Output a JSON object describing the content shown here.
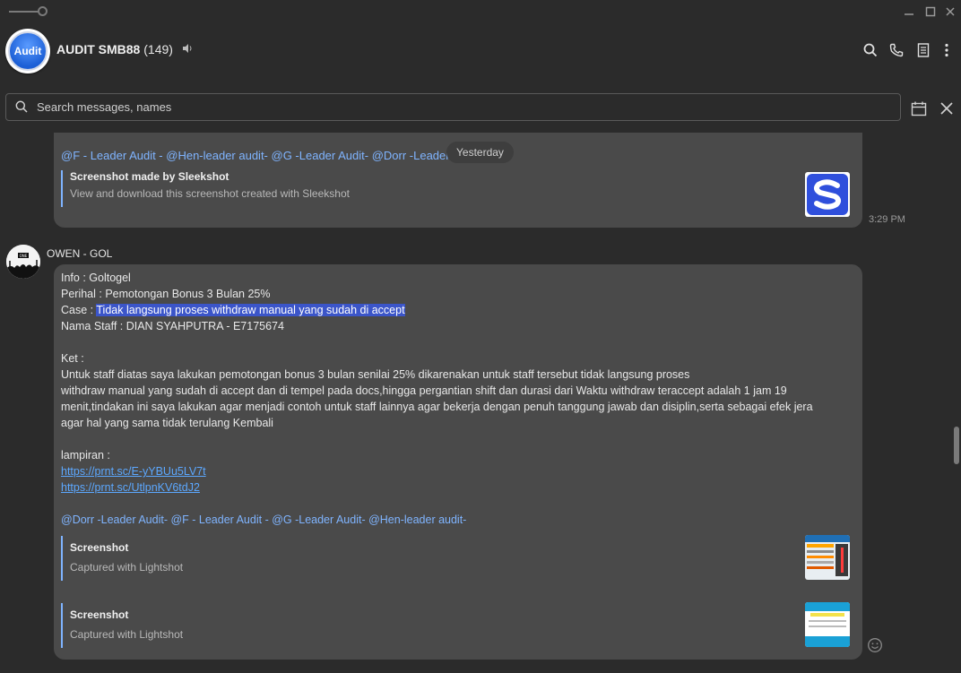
{
  "window": {
    "minimize_glyph": "—",
    "maximize_glyph": "☐",
    "close_glyph": "✕"
  },
  "header": {
    "avatar_text": "Audit",
    "title": "AUDIT SMB88",
    "member_count": "(149)",
    "icons": [
      "search-icon",
      "phone-icon",
      "notes-icon",
      "more-icon"
    ]
  },
  "search": {
    "placeholder": "Search messages, names"
  },
  "date_separator": "Yesterday",
  "messages": [
    {
      "mentions": "@F - Leader Audit - @Hen-leader audit- @G -Leader Audit- @Dorr -Leader Audit-",
      "preview": {
        "title": "Screenshot made by Sleekshot",
        "desc": "View and download this screenshot created with Sleekshot"
      },
      "time": "3:29 PM"
    },
    {
      "sender": "OWEN - GOL",
      "lines": {
        "info": "Info : Goltogel",
        "perihal": "Perihal : Pemotongan Bonus 3 Bulan 25%",
        "case_label": "Case : ",
        "case_value": "Tidak langsung proses withdraw manual yang sudah di accept",
        "staff": "Nama Staff : DIAN SYAHPUTRA - E7175674",
        "ket": "Ket :",
        "ket_body_1": "Untuk staff diatas saya lakukan pemotongan bonus 3 bulan senilai 25% dikarenakan untuk staff tersebut tidak langsung proses",
        "ket_body_2": "withdraw manual yang sudah di accept dan di tempel pada docs,hingga pergantian shift dan durasi dari Waktu withdraw teraccept adalah 1 jam 19",
        "ket_body_3": "menit,tindakan ini saya lakukan agar menjadi contoh untuk staff lainnya agar bekerja dengan penuh tanggung jawab dan disiplin,serta sebagai efek jera",
        "ket_body_4": "agar hal yang sama tidak terulang Kembali",
        "lampiran": "lampiran :",
        "link1": "https://prnt.sc/E-yYBUu5LV7t",
        "link2": "https://prnt.sc/UtlpnKV6tdJ2",
        "mentions": "@Dorr -Leader Audit- @F - Leader Audit - @G -Leader Audit- @Hen-leader audit-"
      },
      "previews": [
        {
          "title": "Screenshot",
          "desc": "Captured with Lightshot"
        },
        {
          "title": "Screenshot",
          "desc": "Captured with Lightshot"
        }
      ]
    }
  ],
  "colors": {
    "background": "#2b2b2b",
    "bubble": "#4a4a4a",
    "mention": "#7fb4ff",
    "highlight": "#3b55c9"
  }
}
